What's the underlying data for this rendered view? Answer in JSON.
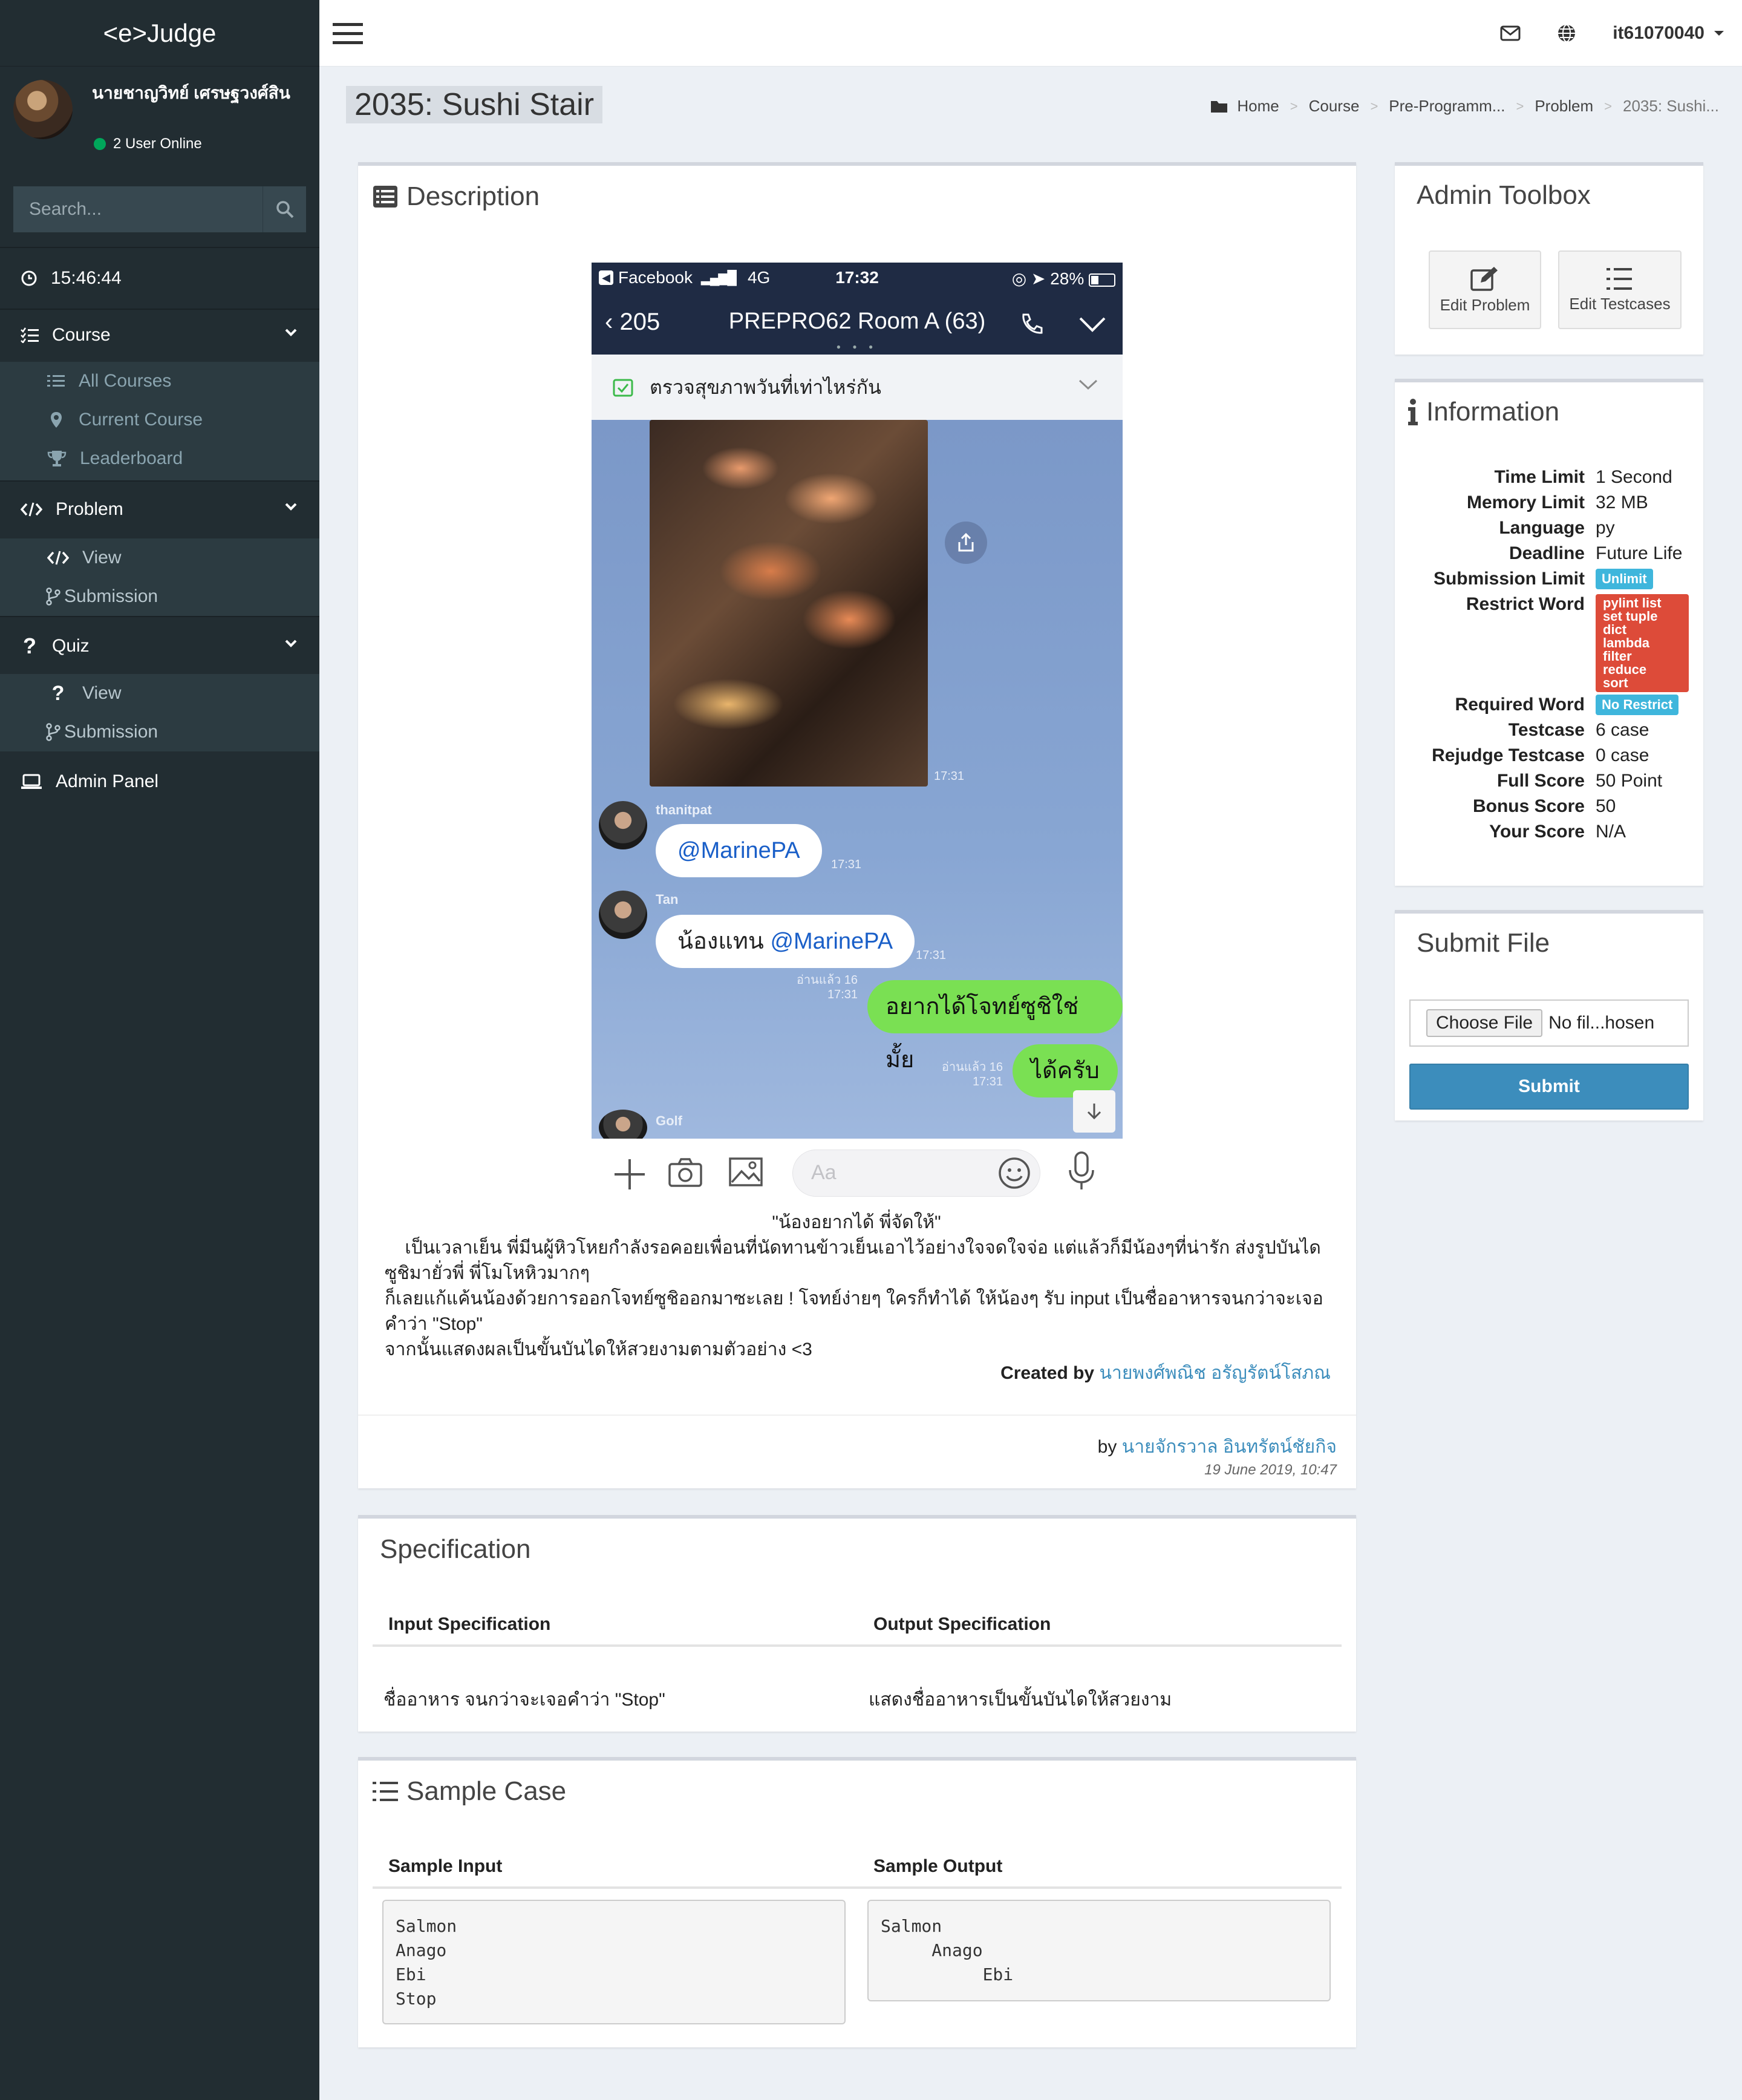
{
  "app": {
    "brand": "<e>Judge"
  },
  "user": {
    "name": "นายชาญวิทย์ เศรษฐวงศ์สิน",
    "online_text": "2 User Online"
  },
  "search": {
    "placeholder": "Search..."
  },
  "clock": "15:46:44",
  "sidebar": {
    "sections": [
      {
        "label": "Course",
        "icon": "list-check-icon",
        "items": [
          {
            "label": "All Courses",
            "icon": "list-icon"
          },
          {
            "label": "Current Course",
            "icon": "map-marker-icon"
          },
          {
            "label": "Leaderboard",
            "icon": "trophy-icon"
          }
        ]
      },
      {
        "label": "Problem",
        "icon": "code-icon",
        "items": [
          {
            "label": "View",
            "icon": "code-icon"
          },
          {
            "label": "Submission",
            "icon": "branch-icon"
          }
        ]
      },
      {
        "label": "Quiz",
        "icon": "question-icon",
        "items": [
          {
            "label": "View",
            "icon": "question-icon"
          },
          {
            "label": "Submission",
            "icon": "branch-icon"
          }
        ]
      }
    ],
    "admin_panel": "Admin Panel"
  },
  "topbar": {
    "username": "it61070040"
  },
  "page": {
    "title": "2035: Sushi Stair",
    "breadcrumb": [
      "Home",
      "Course",
      "Pre-Programm...",
      "Problem",
      "2035: Sushi..."
    ]
  },
  "description": {
    "title": "Description",
    "phone": {
      "status_app": "Facebook",
      "status_net": "4G",
      "status_time": "17:32",
      "status_battery": "28%",
      "back_count": "205",
      "room": "PREPRO62 Room A (63)",
      "notice": "ตรวจสุขภาพวันที่เท่าไหร่กัน",
      "img_time": "17:31",
      "msg1_sender": "thanitpat",
      "msg1_text": "@MarinePA",
      "msg1_time": "17:31",
      "msg2_sender": "Tan",
      "msg2_prefix": "น้องแทน ",
      "msg2_mention": "@MarinePA",
      "msg2_time": "17:31",
      "msg3_read": "อ่านแล้ว 16",
      "msg3_time": "17:31",
      "msg3_text": "อยากได้โจทย์ซูชิใช่มั้ย",
      "msg4_read": "อ่านแล้ว 16",
      "msg4_time": "17:31",
      "msg4_text": "ได้ครับ",
      "msg5_sender": "Golf",
      "input_placeholder": "Aa"
    },
    "quote": "\"น้องอยากได้ พี่จัดให้\"",
    "para1": "    เป็นเวลาเย็น พี่มีนผู้หิวโหยกำลังรอคอยเพื่อนที่นัดทานข้าวเย็นเอาไว้อย่างใจจดใจจ่อ แต่แล้วก็มีน้องๆที่น่ารัก ส่งรูปบันไดซูชิมายั่วพี่ พี่โมโหหิวมากๆ",
    "para2": "ก็เลยแก้แค้นน้องด้วยการออกโจทย์ซูชิออกมาซะเลย ! โจทย์ง่ายๆ ใครก็ทำได้ ให้น้องๆ รับ input เป็นชื่ออาหารจนกว่าจะเจอคำว่า \"Stop\"",
    "para3": "จากนั้นแสดงผลเป็นขั้นบันไดให้สวยงามตามตัวอย่าง <3",
    "created_label": "Created by",
    "created_name": "นายพงศ์พณิช อรัญรัตน์โสภณ",
    "by_label": "by",
    "by_name": "นายจักรวาล อินทรัตน์ชัยกิจ",
    "date": "19 June 2019, 10:47"
  },
  "specification": {
    "title": "Specification",
    "input_header": "Input Specification",
    "output_header": "Output Specification",
    "input_text": "ชื่ออาหาร จนกว่าจะเจอคำว่า \"Stop\"",
    "output_text": "แสดงชื่ออาหารเป็นขั้นบันไดให้สวยงาม"
  },
  "sample": {
    "title": "Sample Case",
    "input_header": "Sample Input",
    "output_header": "Sample Output",
    "input": "Salmon\nAnago\nEbi\nStop",
    "output": "Salmon\n     Anago\n          Ebi"
  },
  "admin_toolbox": {
    "title": "Admin Toolbox",
    "edit_problem": "Edit Problem",
    "edit_testcases": "Edit Testcases"
  },
  "information": {
    "title": "Information",
    "rows": [
      {
        "key": "Time Limit",
        "value": "1 Second"
      },
      {
        "key": "Memory Limit",
        "value": "32 MB"
      },
      {
        "key": "Language",
        "value": "py"
      },
      {
        "key": "Deadline",
        "value": "Future Life"
      },
      {
        "key": "Submission Limit",
        "badge": "Unlimit"
      },
      {
        "key": "Restrict Word",
        "badge": "pylint list\nset tuple\ndict\nlambda\nfilter\nreduce\nsort"
      },
      {
        "key": "Required Word",
        "badge": "No Restrict"
      },
      {
        "key": "Testcase",
        "value": "6 case"
      },
      {
        "key": "Rejudge Testcase",
        "value": "0 case"
      },
      {
        "key": "Full Score",
        "value": "50 Point"
      },
      {
        "key": "Bonus Score",
        "value": "50"
      },
      {
        "key": "Your Score",
        "value": "N/A"
      }
    ],
    "colors": {
      "blue_badge": "#3fb6dc",
      "red_badge": "#dd4b39"
    }
  },
  "submit_file": {
    "title": "Submit File",
    "choose_label": "Choose File",
    "file_label": "No fil...hosen",
    "submit_label": "Submit"
  }
}
